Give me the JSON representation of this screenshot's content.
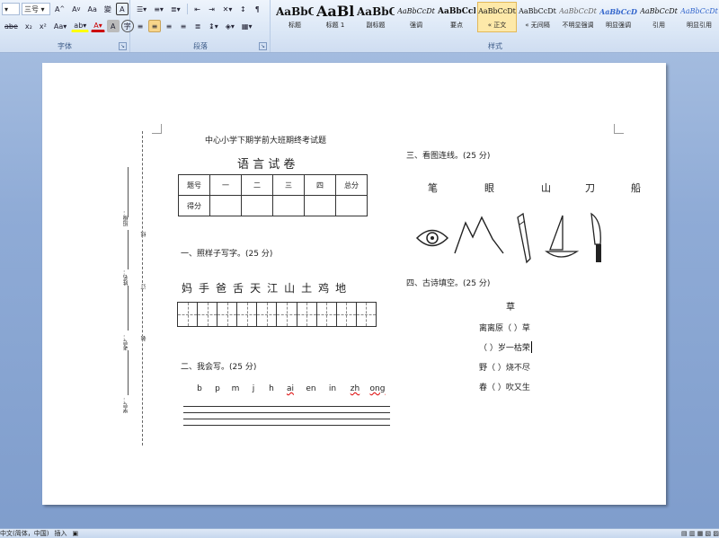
{
  "ribbon": {
    "font_group": {
      "label": "字体",
      "size_value": "三号",
      "grow_icon": "A",
      "shrink_icon": "A",
      "aa_icon": "Aa",
      "wen_icon": "變",
      "clear_icon": "A",
      "strike_label": "abe",
      "sub_label": "x₂",
      "sup_label": "x²",
      "highlight_label": "ab",
      "fontcolor_label": "A",
      "char_label": "A",
      "circle_label": "字"
    },
    "para_group": {
      "label": "段落"
    },
    "styles_group": {
      "label": "样式",
      "items": [
        {
          "preview": "AaBbC",
          "name": "标题"
        },
        {
          "preview": "AaBl",
          "name": "标题 1"
        },
        {
          "preview": "AaBbC",
          "name": "副标题"
        },
        {
          "preview": "AaBbCcDt",
          "name": "强调"
        },
        {
          "preview": "AaBbCcD",
          "name": "要点"
        },
        {
          "preview": "AaBbCcDt",
          "name": "« 正文"
        },
        {
          "preview": "AaBbCcDt",
          "name": "« 无间隔"
        },
        {
          "preview": "AaBbCcDt",
          "name": "不明显强调"
        },
        {
          "preview": "AaBbCcDt",
          "name": "明显强调"
        },
        {
          "preview": "AaBbCcDt",
          "name": "引用"
        },
        {
          "preview": "AaBbCcDt",
          "name": "明显引用"
        }
      ]
    }
  },
  "doc": {
    "header": "中心小学下期学前大班期终考试题",
    "title": "语 言 试 卷",
    "score_table": {
      "headers": [
        "题号",
        "一",
        "二",
        "三",
        "四",
        "总分"
      ],
      "row2_label": "得分"
    },
    "margin_labels": [
      "班级：",
      "姓名：",
      "考号：",
      "学号："
    ],
    "margin_marks": [
      "线",
      "订",
      "装"
    ],
    "q1": {
      "title": "一、照样子写字。(25 分)",
      "chars": [
        "妈",
        "手",
        "爸",
        "舌",
        "天",
        "江",
        "山",
        "土",
        "鸡",
        "地"
      ]
    },
    "q2": {
      "title": "二、我会写。(25 分)",
      "pinyin": [
        "b",
        "p",
        "m",
        "j",
        "h",
        "ai",
        "en",
        "in",
        "zh",
        "ong"
      ]
    },
    "q3": {
      "title": "三、看图连线。(25 分)",
      "words": [
        "笔",
        "眼",
        "山",
        "刀",
        "船"
      ]
    },
    "q4": {
      "title": "四、古诗填空。(25 分)",
      "poem_title": "草",
      "lines": [
        "离离原（    ）草",
        "（      ）岁一枯荣",
        "野（     ）烧不尽",
        "春（     ）吹又生"
      ]
    }
  },
  "status": {
    "language": "中文(简体，中国)",
    "mode": "插入"
  }
}
